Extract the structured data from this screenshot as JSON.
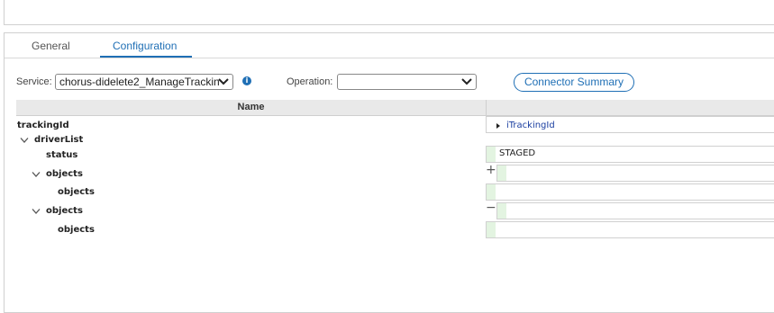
{
  "tabs": [
    {
      "label": "General"
    },
    {
      "label": "Configuration"
    }
  ],
  "service": {
    "label": "Service:",
    "value": "chorus-didelete2_ManageTrackin"
  },
  "operation": {
    "label": "Operation:",
    "value": ""
  },
  "connector_summary": {
    "label": "Connector Summary"
  },
  "info_icon": {
    "glyph": "i"
  },
  "grid": {
    "header_name": "Name",
    "rows": [
      {
        "label": "trackingId"
      },
      {
        "label": "driverList"
      },
      {
        "label": "status"
      },
      {
        "label": "objects"
      },
      {
        "label": "objects"
      },
      {
        "label": "objects"
      },
      {
        "label": "objects"
      }
    ],
    "mapping": {
      "trackingId": "iTrackingId",
      "status": "STAGED"
    }
  },
  "icons": {
    "plus": "+",
    "minus": "−"
  },
  "colors": {
    "accent": "#1f6fb5",
    "mapping_bar": "#e3f4e1",
    "link": "#1a3ea0"
  }
}
